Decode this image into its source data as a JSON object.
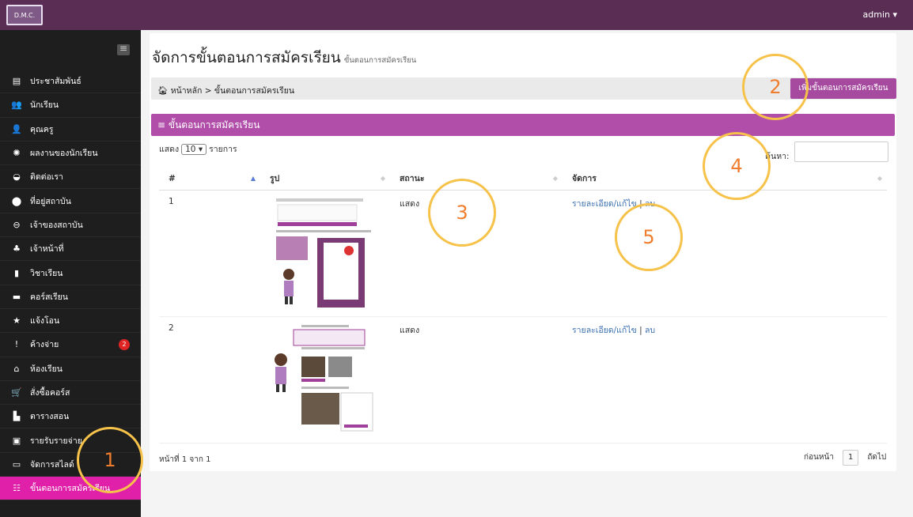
{
  "topbar": {
    "logo": "D.M.C.",
    "user": "admin ▾"
  },
  "sidebar": {
    "items": [
      {
        "icon": "▤",
        "label": "ประชาสัมพันธ์"
      },
      {
        "icon": "👥",
        "label": "นักเรียน"
      },
      {
        "icon": "👤",
        "label": "คุณครู"
      },
      {
        "icon": "✺",
        "label": "ผลงานของนักเรียน"
      },
      {
        "icon": "◒",
        "label": "ติดต่อเรา"
      },
      {
        "icon": "⬤",
        "label": "ที่อยู่สถาบัน"
      },
      {
        "icon": "⊖",
        "label": "เจ้าของสถาบัน"
      },
      {
        "icon": "♣",
        "label": "เจ้าหน้าที่"
      },
      {
        "icon": "▮",
        "label": "วิชาเรียน"
      },
      {
        "icon": "▬",
        "label": "คอร์สเรียน"
      },
      {
        "icon": "★",
        "label": "แจ้งโอน"
      },
      {
        "icon": "!",
        "label": "ค้างจ่าย",
        "badge": "2"
      },
      {
        "icon": "⌂",
        "label": "ห้องเรียน"
      },
      {
        "icon": "🛒",
        "label": "สั่งซื้อคอร์ส"
      },
      {
        "icon": "▙",
        "label": "ตารางสอน"
      },
      {
        "icon": "▣",
        "label": "รายรับรายจ่าย"
      },
      {
        "icon": "▭",
        "label": "จัดการสไลด์"
      },
      {
        "icon": "☷",
        "label": "ขั้นตอนการสมัครเรียน"
      }
    ]
  },
  "page": {
    "title": "จัดการขั้นตอนการสมัครเรียน",
    "subtitle": "ขั้นตอนการสมัครเรียน",
    "breadcrumb_home": "หน้าหลัก",
    "breadcrumb_current": "ขั้นตอนการสมัครเรียน",
    "add_button": "เพิ่มขั้นตอนการสมัครเรียน",
    "panel_title": "≡ ขั้นตอนการสมัครเรียน",
    "show_prefix": "แสดง",
    "show_value": "10 ▾",
    "show_suffix": "รายการ",
    "search_label": "ค้นหา:"
  },
  "table": {
    "headers": [
      "#",
      "รูป",
      "สถานะ",
      "จัดการ"
    ],
    "rows": [
      {
        "num": "1",
        "status": "แสดง",
        "edit": "รายละเอียด/แก้ไข",
        "sep": "|",
        "delete": "ลบ"
      },
      {
        "num": "2",
        "status": "แสดง",
        "edit": "รายละเอียด/แก้ไข",
        "sep": "|",
        "delete": "ลบ"
      }
    ]
  },
  "pager": {
    "info": "หน้าที่ 1 จาก 1",
    "prev": "ก่อนหน้า",
    "current": "1",
    "next": "ถัดไป"
  },
  "annotations": [
    "1",
    "2",
    "3",
    "4",
    "5"
  ],
  "colors": {
    "topbar": "#5a2d55",
    "sidebar": "#1e1e1e",
    "active": "#e020a8",
    "panel": "#b04ea9",
    "circle": "#f6c24a",
    "circle_text": "#ef7d2d"
  }
}
